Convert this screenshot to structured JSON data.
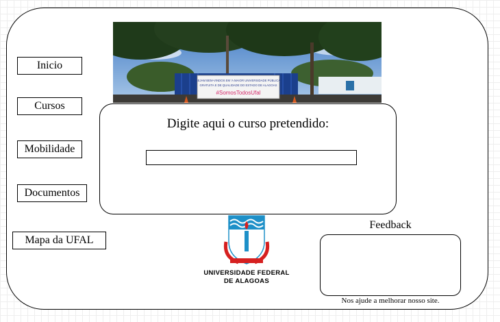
{
  "nav": {
    "items": [
      {
        "id": "inicio",
        "label": "Inicio"
      },
      {
        "id": "cursos",
        "label": "Cursos"
      },
      {
        "id": "mobilidade",
        "label": "Mobilidade"
      },
      {
        "id": "documentos",
        "label": "Documentos"
      },
      {
        "id": "mapa",
        "label": "Mapa da UFAL"
      }
    ]
  },
  "banner": {
    "line1": "SEJAM BEM-VINDOS EM 'A MAIOR UNIVERSIDADE PÚBLICA,",
    "line2": "GRATUITA E DE QUALIDADE DO ESTADO DE ALAGOAS",
    "hashtag": "#SomosTodosUfal"
  },
  "search": {
    "title": "Digite aqui o curso pretendido:",
    "value": "",
    "placeholder": ""
  },
  "logo": {
    "line1": "UNIVERSIDADE FEDERAL",
    "line2": "DE ALAGOAS"
  },
  "feedback": {
    "label": "Feedback",
    "hint": "Nos ajude a melhorar nosso site.",
    "value": ""
  },
  "colors": {
    "logo_blue": "#1e90c8",
    "logo_red": "#d62020",
    "banner_hashtag": "#d42a6a"
  }
}
